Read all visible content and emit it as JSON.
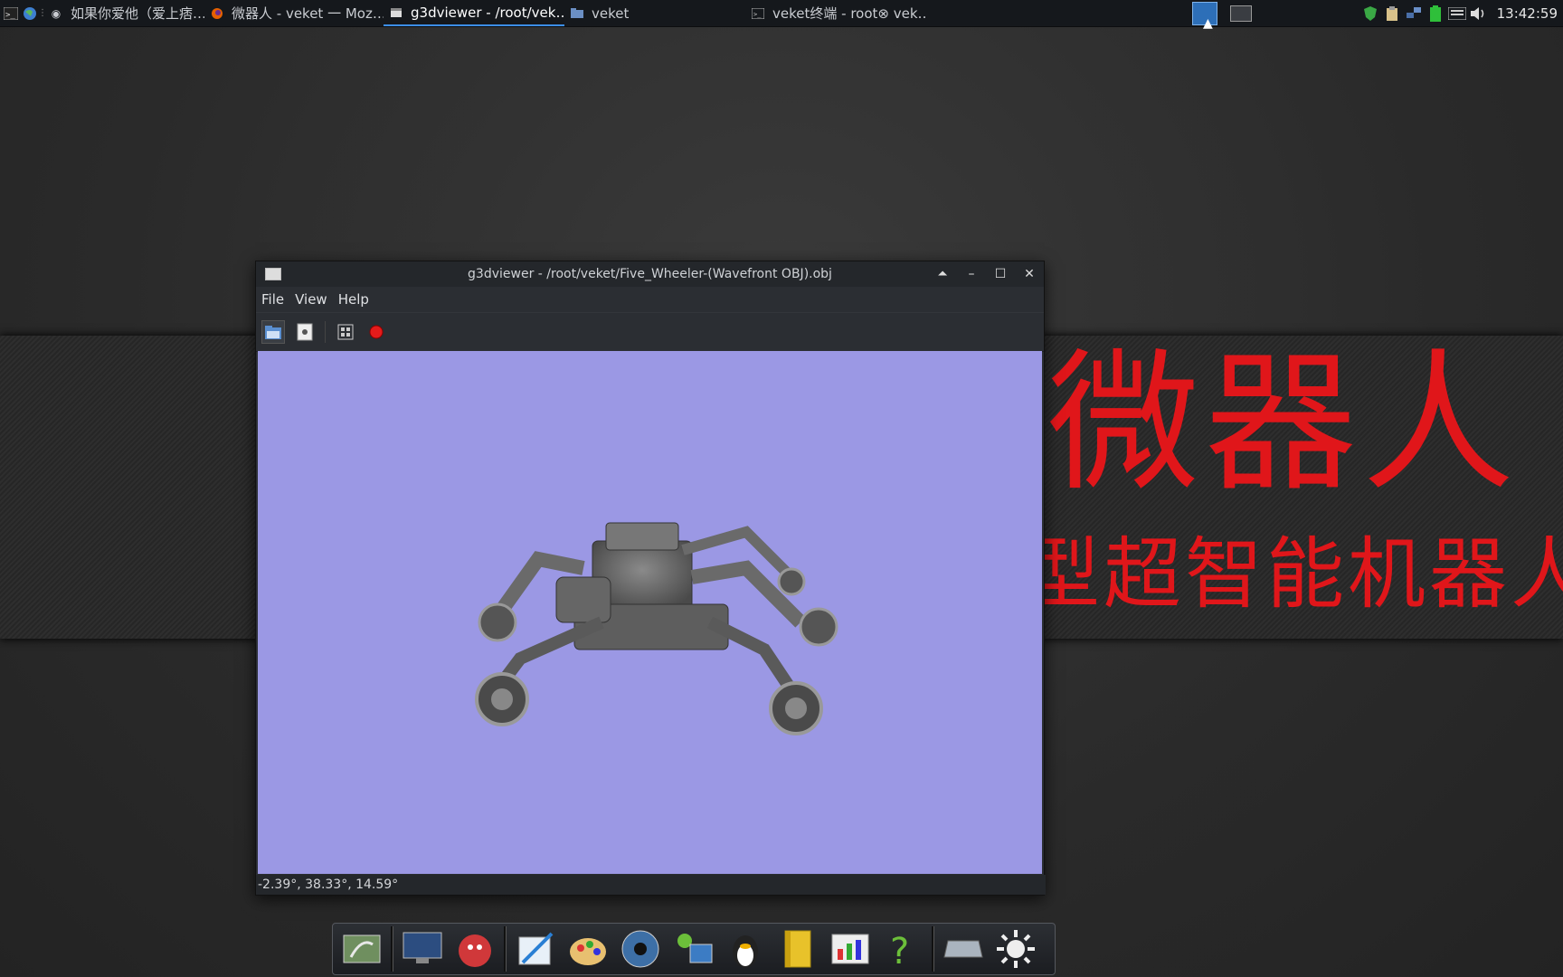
{
  "taskbar": {
    "tasks": [
      {
        "label": "如果你爱他（爱上痞…",
        "icon": "radio-icon"
      },
      {
        "label": "微器人 - veket 一 Moz…",
        "icon": "firefox-icon"
      },
      {
        "label": "g3dviewer - /root/vek…",
        "icon": "window-icon",
        "active": true
      },
      {
        "label": "veket",
        "icon": "folder-icon"
      },
      {
        "label": "veket终端 - root⊗ vek…",
        "icon": "terminal-icon"
      }
    ],
    "clock": "13:42:59"
  },
  "wallpaper": {
    "title": "微器人",
    "subtitle": "型超智能机器人"
  },
  "window": {
    "title": "g3dviewer - /root/veket/Five_Wheeler-(Wavefront OBJ).obj",
    "menu": [
      "File",
      "View",
      "Help"
    ],
    "toolbar": [
      "open-icon",
      "properties-icon",
      "screenshot-icon",
      "record-icon"
    ],
    "status": "-2.39°, 38.33°, 14.59°",
    "viewport_bg": "#9b98e4"
  },
  "dock": {
    "items": [
      "file-manager-icon",
      "monitor-icon",
      "pet-icon",
      "text-editor-icon",
      "paint-icon",
      "media-player-icon",
      "network-icon",
      "qq-icon",
      "notebook-icon",
      "office-icon",
      "help-icon",
      "drive-icon",
      "settings-icon"
    ]
  }
}
